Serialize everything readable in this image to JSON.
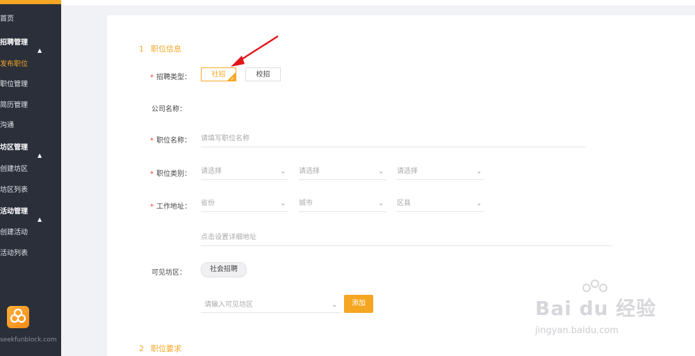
{
  "sidebar": {
    "items": [
      {
        "label": "首页"
      },
      {
        "label": "招聘管理",
        "group": true
      },
      {
        "label": "发布职位",
        "active": true
      },
      {
        "label": "职位管理"
      },
      {
        "label": "简历管理"
      },
      {
        "label": "沟通"
      },
      {
        "label": "坊区管理",
        "group": true
      },
      {
        "label": "创建坊区"
      },
      {
        "label": "坊区列表"
      },
      {
        "label": "活动管理",
        "group": true
      },
      {
        "label": "创建活动"
      },
      {
        "label": "活动列表"
      }
    ],
    "caret": "▲",
    "domain": "seekfunblock.com"
  },
  "section1": {
    "num": "1",
    "title": "职位信息"
  },
  "section2": {
    "num": "2",
    "title": "职位要求"
  },
  "form": {
    "required_mark": "*",
    "recruit_type_label": "招聘类型：",
    "recruit_type_options": [
      "社招",
      "校招"
    ],
    "recruit_type_selected": "社招",
    "check_glyph": "✓",
    "company_label": "公司名称：",
    "job_name_label": "职位名称：",
    "job_name_placeholder": "请填写职位名称",
    "job_category_label": "职位类别：",
    "job_category_selects": [
      "请选择",
      "请选择",
      "请选择"
    ],
    "address_label": "工作地址：",
    "address_selects": [
      "省份",
      "城市",
      "区县"
    ],
    "detail_address_placeholder": "点击设置详细地址",
    "visible_area_label": "可见坊区：",
    "visible_area_tag": "社会招聘",
    "visible_area_input_placeholder": "请输入可见坊区",
    "add_button": "添加",
    "chevron": "⌄"
  },
  "watermark": {
    "text": "Bai du 经验",
    "sub": "jingyan.baidu.com"
  },
  "colors": {
    "accent": "#f5a623",
    "sidebar_bg": "#2a2f3a",
    "required": "#e23b3b",
    "arrow": "#e0161b"
  }
}
